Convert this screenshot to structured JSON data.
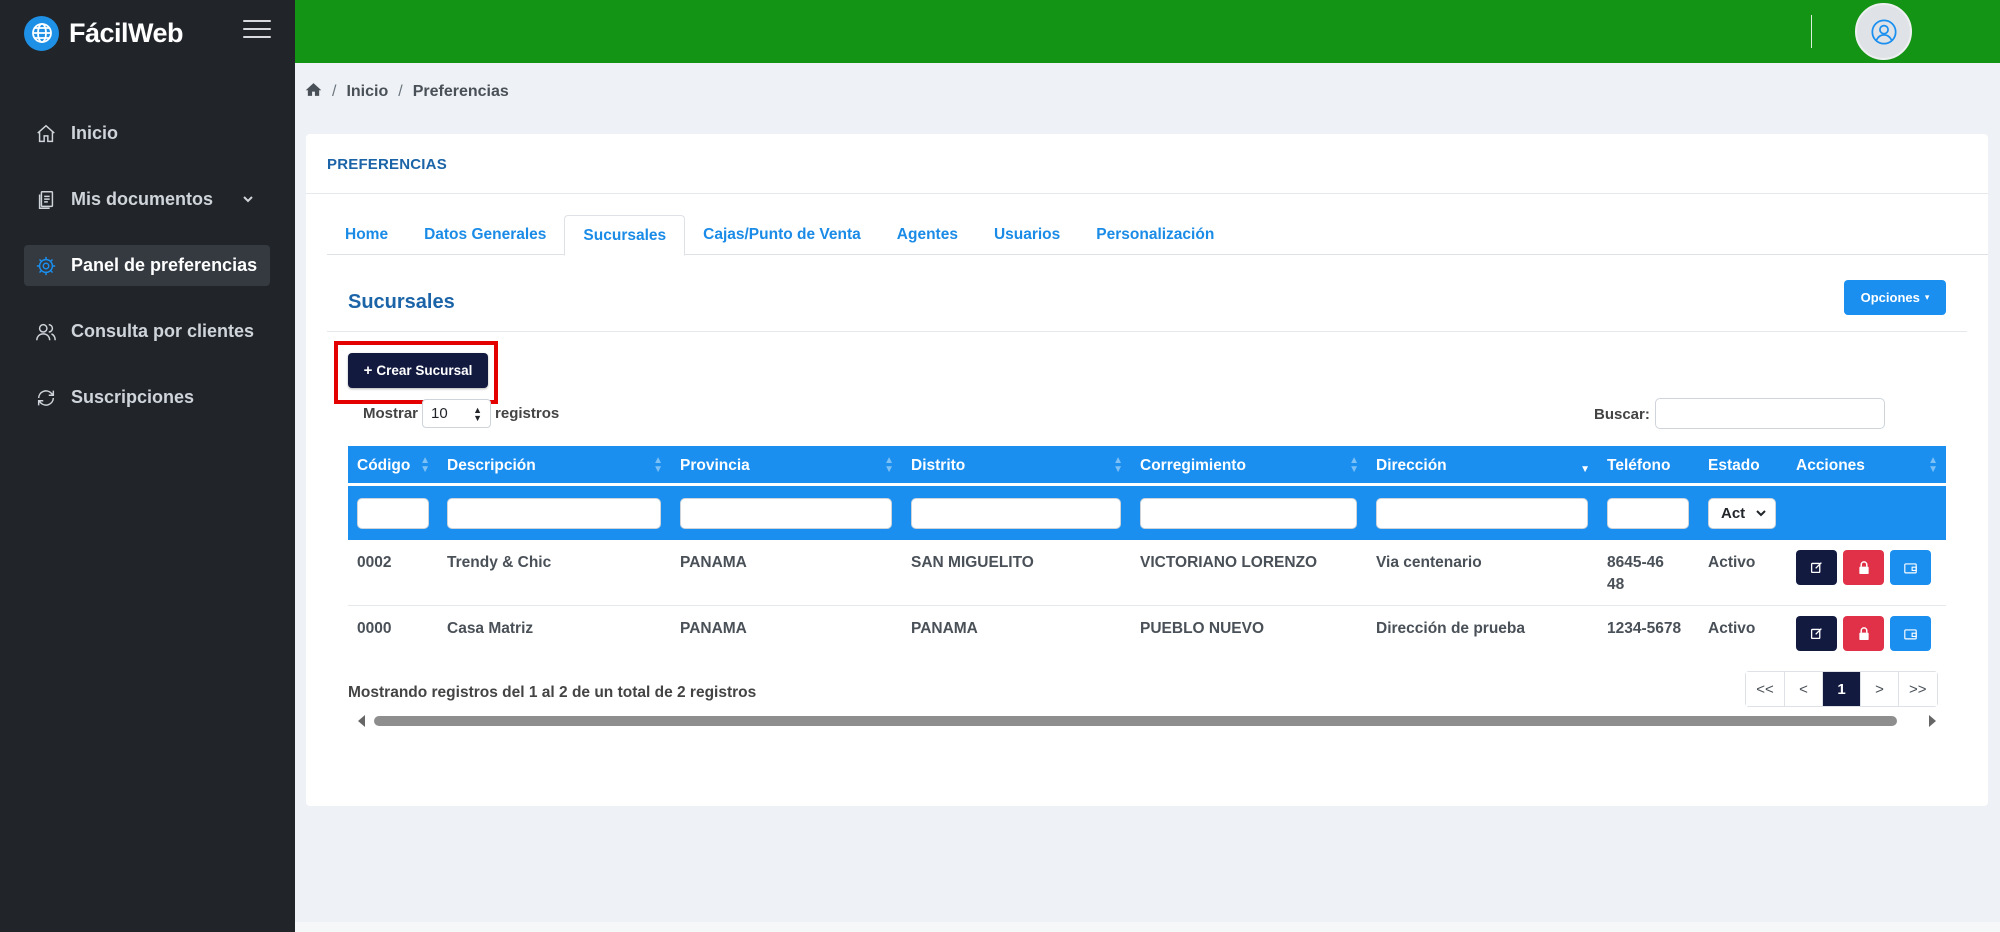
{
  "brand": {
    "name": "FácilWeb"
  },
  "sidebar": {
    "items": [
      {
        "label": "Inicio",
        "icon": "home-icon"
      },
      {
        "label": "Mis documentos",
        "icon": "documents-icon"
      },
      {
        "label": "Panel de preferencias",
        "icon": "gear-icon"
      },
      {
        "label": "Consulta por clientes",
        "icon": "users-icon"
      },
      {
        "label": "Suscripciones",
        "icon": "refresh-icon"
      }
    ]
  },
  "breadcrumb": {
    "home": "Inicio",
    "current": "Preferencias"
  },
  "card": {
    "title": "PREFERENCIAS"
  },
  "tabs": [
    "Home",
    "Datos Generales",
    "Sucursales",
    "Cajas/Punto de Venta",
    "Agentes",
    "Usuarios",
    "Personalización"
  ],
  "section": {
    "title": "Sucursales",
    "options_label": "Opciones",
    "create_label": "Crear Sucursal"
  },
  "list_controls": {
    "show_label": "Mostrar",
    "show_value": "10",
    "records_label": "registros",
    "search_label": "Buscar:",
    "estado_filter": "Act"
  },
  "table": {
    "columns": [
      "Código",
      "Descripción",
      "Provincia",
      "Distrito",
      "Corregimiento",
      "Dirección",
      "Teléfono",
      "Estado",
      "Acciones"
    ],
    "rows": [
      {
        "codigo": "0002",
        "descripcion": "Trendy & Chic",
        "provincia": "PANAMA",
        "distrito": "SAN MIGUELITO",
        "corregimiento": "VICTORIANO LORENZO",
        "direccion": "Via centenario",
        "telefono": "8645-4648",
        "estado": "Activo"
      },
      {
        "codigo": "0000",
        "descripcion": "Casa Matriz",
        "provincia": "PANAMA",
        "distrito": "PANAMA",
        "corregimiento": "PUEBLO NUEVO",
        "direccion": "Dirección de prueba",
        "telefono": "1234-5678",
        "estado": "Activo"
      }
    ]
  },
  "footer": {
    "info": "Mostrando registros del 1 al 2 de un total de 2 registros"
  },
  "pagination": {
    "first": "<<",
    "prev": "<",
    "current": "1",
    "next": ">",
    "last": ">>"
  },
  "colors": {
    "header_green": "#149414",
    "sidebar_dark": "#212529",
    "primary_blue": "#1a8ff0",
    "navy": "#121a40",
    "danger": "#e03148",
    "highlight_red": "#e50000"
  }
}
